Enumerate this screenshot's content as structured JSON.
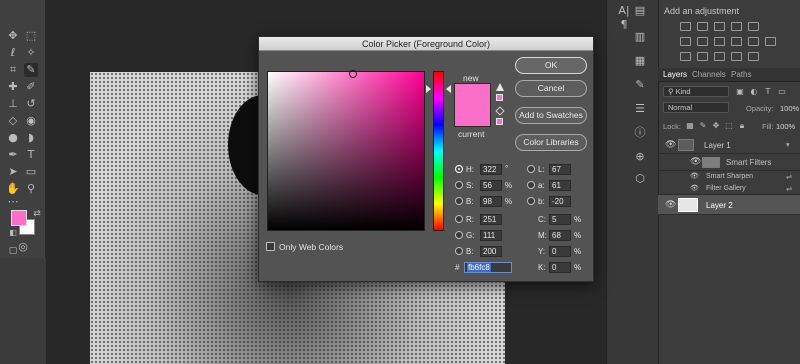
{
  "dialog": {
    "title": "Color Picker (Foreground Color)",
    "new_label": "new",
    "current_label": "current",
    "buttons": {
      "ok": "OK",
      "cancel": "Cancel",
      "add_to_swatches": "Add to Swatches",
      "color_libraries": "Color Libraries"
    },
    "only_web_colors": "Only Web Colors",
    "fields": {
      "H": {
        "label": "H:",
        "value": "322",
        "unit": "°"
      },
      "S": {
        "label": "S:",
        "value": "56",
        "unit": "%"
      },
      "B": {
        "label": "B:",
        "value": "98",
        "unit": "%"
      },
      "R": {
        "label": "R:",
        "value": "251",
        "unit": ""
      },
      "G": {
        "label": "G:",
        "value": "111",
        "unit": ""
      },
      "Bl": {
        "label": "B:",
        "value": "200",
        "unit": ""
      },
      "L": {
        "label": "L:",
        "value": "67",
        "unit": ""
      },
      "a": {
        "label": "a:",
        "value": "61",
        "unit": ""
      },
      "b": {
        "label": "b:",
        "value": "-20",
        "unit": ""
      },
      "C": {
        "label": "C:",
        "value": "5",
        "unit": "%"
      },
      "M": {
        "label": "M:",
        "value": "68",
        "unit": "%"
      },
      "Y": {
        "label": "Y:",
        "value": "0",
        "unit": "%"
      },
      "K": {
        "label": "K:",
        "value": "0",
        "unit": "%"
      }
    },
    "hex_prefix": "#",
    "hex_value": "fb6fc8",
    "selected_color": "#fb6fc8"
  },
  "adjustments": {
    "title": "Add an adjustment"
  },
  "layers_panel": {
    "tabs": [
      "Layers",
      "Channels",
      "Paths"
    ],
    "kind_filter": "Kind",
    "blend_mode": "Normal",
    "opacity_label": "Opacity:",
    "opacity_value": "100%",
    "lock_label": "Lock:",
    "fill_label": "Fill:",
    "fill_value": "100%",
    "layers": [
      {
        "name": "Layer 1"
      },
      {
        "name": "Smart Filters"
      },
      {
        "name": "Smart Sharpen"
      },
      {
        "name": "Filter Gallery"
      },
      {
        "name": "Layer 2"
      }
    ]
  },
  "toolbar": {
    "foreground_color": "#fb6fc8",
    "background_color": "#ffffff"
  }
}
